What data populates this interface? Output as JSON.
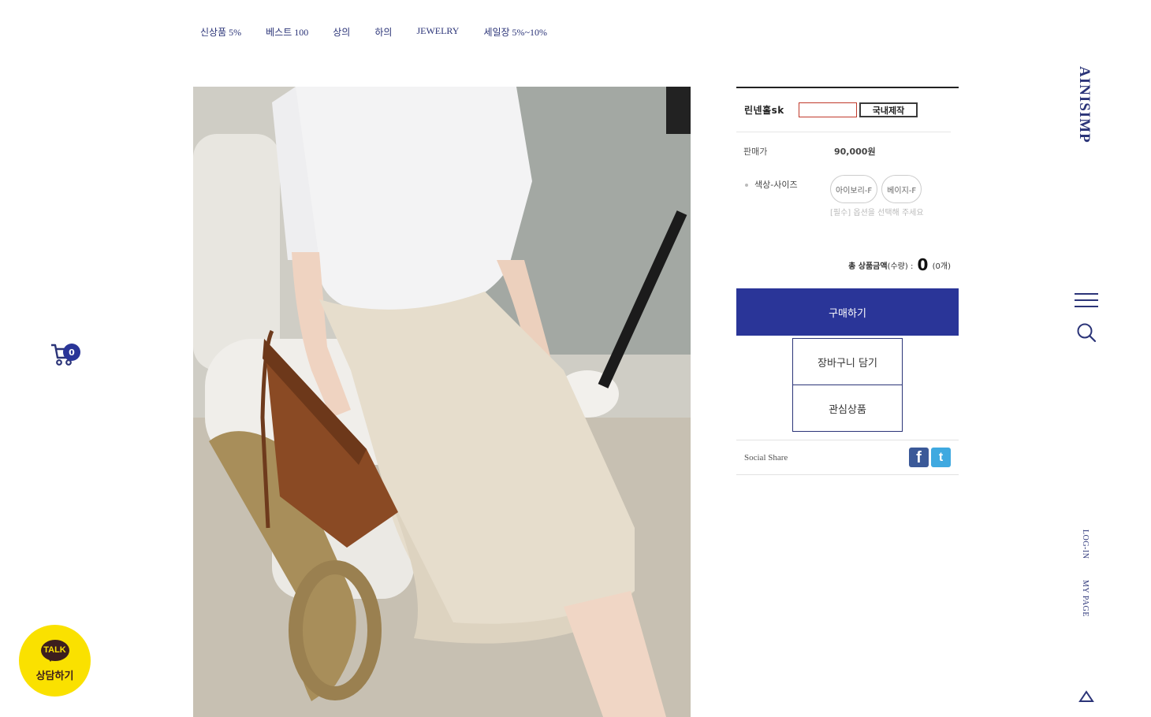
{
  "nav": {
    "items": [
      "신상품 5%",
      "베스트 100",
      "상의",
      "하의",
      "JEWELRY",
      "세일장 5%~10%"
    ]
  },
  "brand": {
    "logo": "AINISIMP"
  },
  "product": {
    "name": "린넨홀sk",
    "badge": "국내제작",
    "price_label": "판매가",
    "price": "90,000원",
    "option_label": "색상-사이즈",
    "options": [
      "아이보리-F",
      "베이지-F"
    ],
    "option_hint": "[필수] 옵션을 선택해 주세요",
    "total_label": "총 상품금액",
    "total_qty_label": "(수량) :",
    "total_value": "0",
    "total_count": "(0개)"
  },
  "actions": {
    "buy": "구매하기",
    "cart": "장바구니 담기",
    "wish": "관심상품"
  },
  "share": {
    "label": "Social Share",
    "facebook": "f",
    "twitter": "t"
  },
  "sidebar": {
    "login": "LOG-IN",
    "mypage": "MY PAGE"
  },
  "floating": {
    "cart_count": "0",
    "talk_bubble": "TALK",
    "talk_label": "상담하기"
  },
  "colors": {
    "brand_blue": "#2a3598",
    "kakao_yellow": "#fae100"
  },
  "icons": [
    "hamburger-icon",
    "search-icon",
    "cart-icon",
    "scroll-top-icon",
    "facebook-icon",
    "twitter-icon"
  ]
}
